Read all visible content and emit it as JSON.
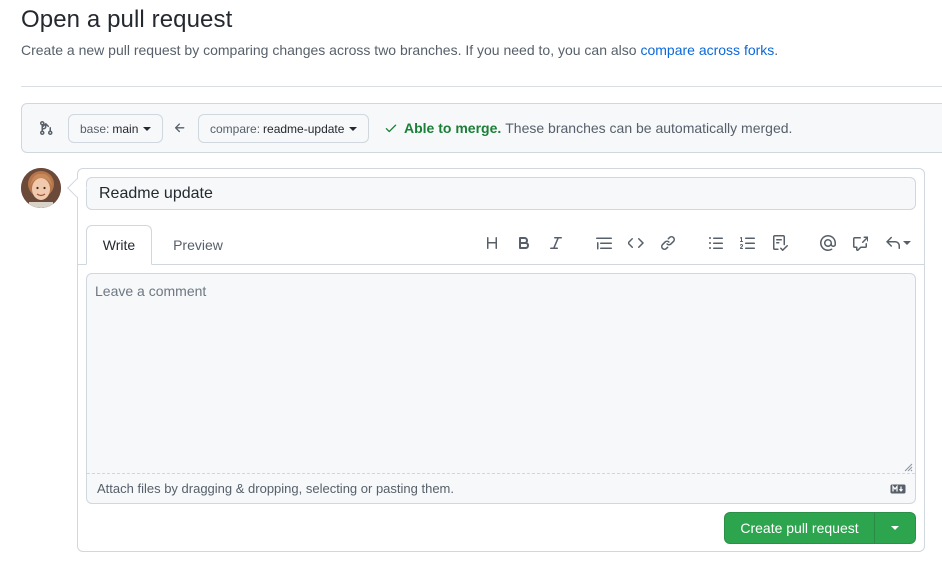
{
  "page": {
    "title": "Open a pull request",
    "subtitle": "Create a new pull request by comparing changes across two branches. If you need to, you can also ",
    "subtitle_link": "compare across forks",
    "subtitle_end": "."
  },
  "range": {
    "base_label": "base:",
    "base_value": "main",
    "compare_label": "compare:",
    "compare_value": "readme-update",
    "merge_ok": "Able to merge.",
    "merge_note": "These branches can be automatically merged."
  },
  "composer": {
    "title_value": "Readme update",
    "tabs": [
      {
        "label": "Write",
        "active": true
      },
      {
        "label": "Preview",
        "active": false
      }
    ],
    "comment_placeholder": "Leave a comment",
    "attach_text": "Attach files by dragging & dropping, selecting or pasting them.",
    "toolbar_icons": [
      "heading-icon",
      "bold-icon",
      "italic-icon",
      "quote-icon",
      "code-icon",
      "link-icon",
      "unordered-list-icon",
      "ordered-list-icon",
      "task-list-icon",
      "mention-icon",
      "cross-reference-icon",
      "reply-icon"
    ],
    "submit_label": "Create pull request"
  },
  "colors": {
    "accent_link": "#0969da",
    "success": "#1a7f37",
    "primary_button": "#2da44e"
  }
}
